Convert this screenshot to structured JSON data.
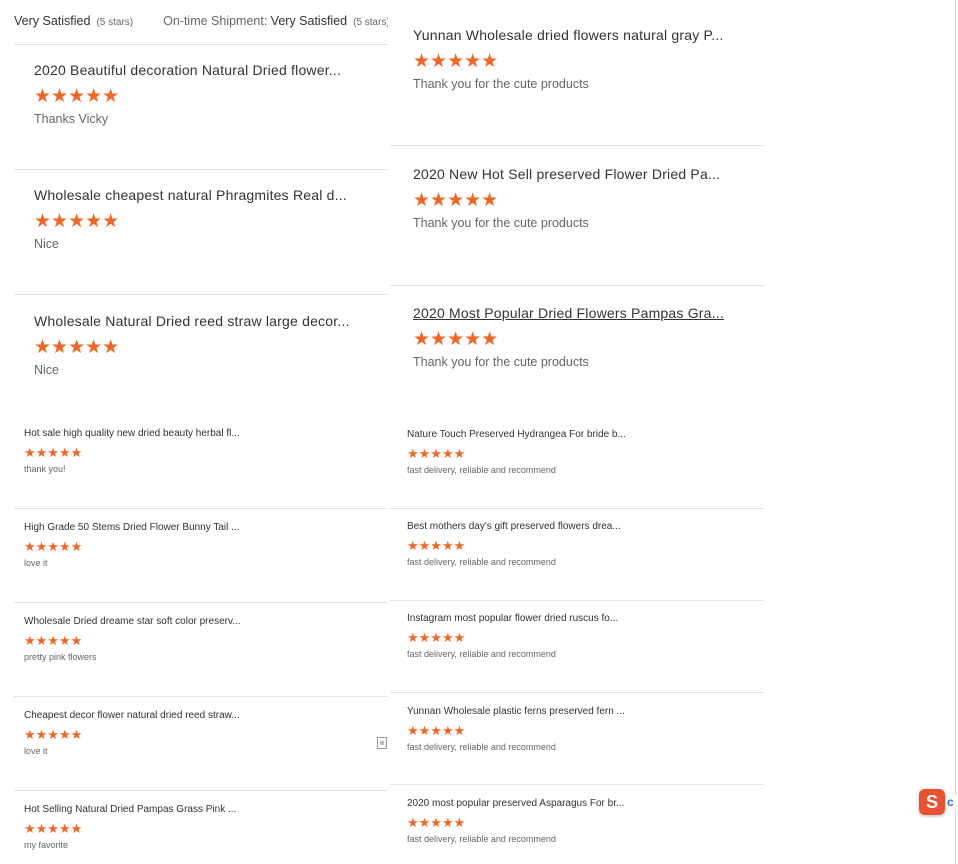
{
  "summary": {
    "rating_label": "Very Satisfied",
    "rating_stars": "(5 stars)",
    "shipment_label": "On-time Shipment:",
    "shipment_value": "Very Satisfied",
    "shipment_stars": "(5 stars)"
  },
  "star_glyph": "★★★★★",
  "accent_color": "#f26522",
  "left_reviews": [
    {
      "title": "2020 Beautiful decoration Natural Dried flower...",
      "comment": "Thanks Vicky",
      "rating": 5
    },
    {
      "title": "Wholesale cheapest natural Phragmites Real d...",
      "comment": "Nice",
      "rating": 5
    },
    {
      "title": "Wholesale Natural Dried reed straw large decor...",
      "comment": "Nice",
      "rating": 5
    },
    {
      "title": "Hot sale high quality new dried beauty herbal fl...",
      "comment": "thank you!",
      "rating": 5
    },
    {
      "title": "High Grade 50 Stems Dried Flower Bunny Tail ...",
      "comment": "love it",
      "rating": 5
    },
    {
      "title": "Wholesale Dried dreame star soft color preserv...",
      "comment": "pretty pink flowers",
      "rating": 5
    },
    {
      "title": "Cheapest decor flower natural dried reed straw...",
      "comment": "love it",
      "rating": 5
    },
    {
      "title": "Hot Selling Natural Dried Pampas Grass Pink ...",
      "comment": "my favorite",
      "rating": 5
    }
  ],
  "right_reviews": [
    {
      "title": "Yunnan Wholesale dried flowers natural gray P...",
      "comment": "Thank you for the cute products",
      "rating": 5
    },
    {
      "title": "2020 New Hot Sell preserved Flower Dried Pa...",
      "comment": "Thank you for the cute products",
      "rating": 5
    },
    {
      "title": "2020 Most Popular Dried Flowers Pampas Gra...",
      "comment": "Thank you for the cute products",
      "rating": 5
    },
    {
      "title": "Nature Touch Preserved Hydrangea For bride b...",
      "comment": "fast delivery, reliable and recommend",
      "rating": 5
    },
    {
      "title": "Best mothers day's gift preserved flowers drea...",
      "comment": "fast delivery, reliable and recommend",
      "rating": 5
    },
    {
      "title": "Instagram most popular flower dried ruscus fo...",
      "comment": "fast delivery, reliable and recommend",
      "rating": 5
    },
    {
      "title": "Yunnan Wholesale plastic ferns preserved fern ...",
      "comment": "fast delivery, reliable and recommend",
      "rating": 5
    },
    {
      "title": "2020 most popular preserved Asparagus For br...",
      "comment": "fast delivery, reliable and recommend",
      "rating": 5
    }
  ],
  "widget": {
    "logo_letter": "S",
    "peek_letter": "c"
  }
}
